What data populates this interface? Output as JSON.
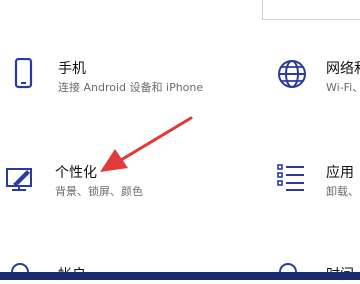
{
  "settings": {
    "tiles": [
      {
        "title": "手机",
        "subtitle": "连接 Android 设备和 iPhone",
        "icon": "phone-icon"
      },
      {
        "title": "网络和",
        "subtitle": "Wi-Fi、",
        "icon": "globe-icon"
      },
      {
        "title": "个性化",
        "subtitle": "背景、锁屏、颜色",
        "icon": "personalization-icon"
      },
      {
        "title": "应用",
        "subtitle": "卸载、",
        "icon": "apps-list-icon"
      }
    ],
    "bottom_cut": [
      "帐户",
      "时间"
    ]
  },
  "colors": {
    "accent": "#2b3aa0",
    "annotation_arrow": "#e03a3a",
    "taskbar": "#1a2a6e"
  }
}
